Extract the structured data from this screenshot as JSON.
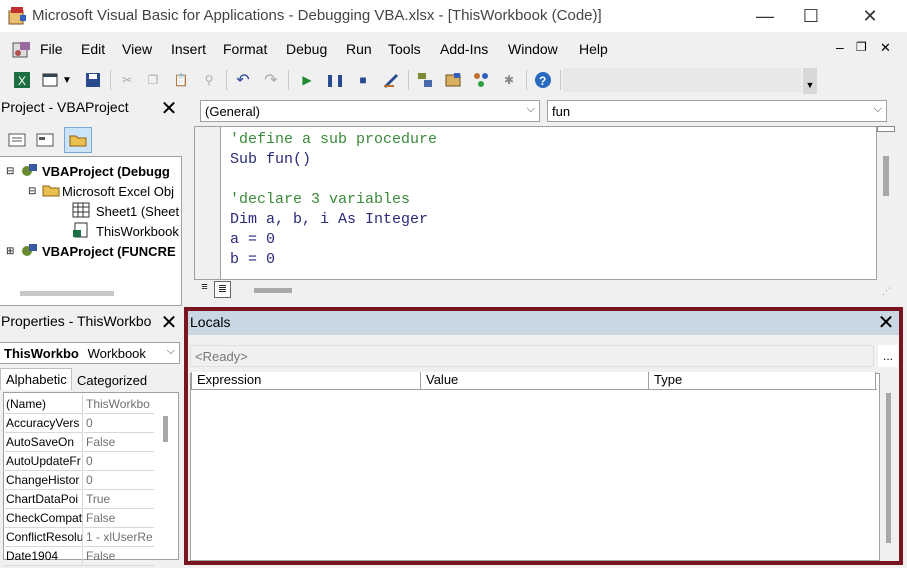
{
  "window": {
    "title": "Microsoft Visual Basic for Applications - Debugging VBA.xlsx - [ThisWorkbook (Code)]",
    "minimize": "—",
    "maximize": "☐",
    "close": "✕"
  },
  "menu": {
    "items": [
      {
        "label": "File"
      },
      {
        "label": "Edit"
      },
      {
        "label": "View"
      },
      {
        "label": "Insert"
      },
      {
        "label": "Format"
      },
      {
        "label": "Debug"
      },
      {
        "label": "Run"
      },
      {
        "label": "Tools"
      },
      {
        "label": "Add-Ins"
      },
      {
        "label": "Window"
      },
      {
        "label": "Help"
      }
    ],
    "doc_min": "–",
    "doc_restore": "❐",
    "doc_close": "✕"
  },
  "project_panel": {
    "title": "Project - VBAProject",
    "close": "✕",
    "tree": [
      {
        "label": "VBAProject (Debugg"
      },
      {
        "label": "Microsoft Excel Obj"
      },
      {
        "label": "Sheet1 (Sheet"
      },
      {
        "label": "ThisWorkbook"
      },
      {
        "label": "VBAProject (FUNCRE"
      }
    ]
  },
  "properties_panel": {
    "title": "Properties - ThisWorkbo",
    "close": "✕",
    "object_name": "ThisWorkbo",
    "object_type": "Workbook",
    "tabs": [
      {
        "label": "Alphabetic"
      },
      {
        "label": "Categorized"
      }
    ],
    "rows": [
      {
        "name": "(Name)",
        "value": "ThisWorkbo"
      },
      {
        "name": "AccuracyVers",
        "value": "0"
      },
      {
        "name": "AutoSaveOn",
        "value": "False"
      },
      {
        "name": "AutoUpdateFr",
        "value": "0"
      },
      {
        "name": "ChangeHistor",
        "value": "0"
      },
      {
        "name": "ChartDataPoi",
        "value": "True"
      },
      {
        "name": "CheckCompat",
        "value": "False"
      },
      {
        "name": "ConflictResolu",
        "value": "1 - xlUserRe"
      },
      {
        "name": "Date1904",
        "value": "False"
      }
    ]
  },
  "code_window": {
    "object_combo": "(General)",
    "proc_combo": "fun",
    "lines": [
      {
        "text": "'define a sub procedure",
        "kind": "comment"
      },
      {
        "text": "Sub fun()",
        "kind": "code"
      },
      {
        "text": "",
        "kind": "code"
      },
      {
        "text": "'declare 3 variables",
        "kind": "comment"
      },
      {
        "text": "Dim a, b, i As Integer",
        "kind": "code"
      },
      {
        "text": "a = 0",
        "kind": "code"
      },
      {
        "text": "b = 0",
        "kind": "code"
      }
    ]
  },
  "locals_window": {
    "title": "Locals",
    "close": "✕",
    "status": "<Ready>",
    "ellipsis": "...",
    "columns": [
      {
        "label": "Expression"
      },
      {
        "label": "Value"
      },
      {
        "label": "Type"
      }
    ]
  },
  "colors": {
    "highlight_border": "#7a1420",
    "panel_header": "#c9d7e3",
    "comment": "#3a8a3a"
  }
}
